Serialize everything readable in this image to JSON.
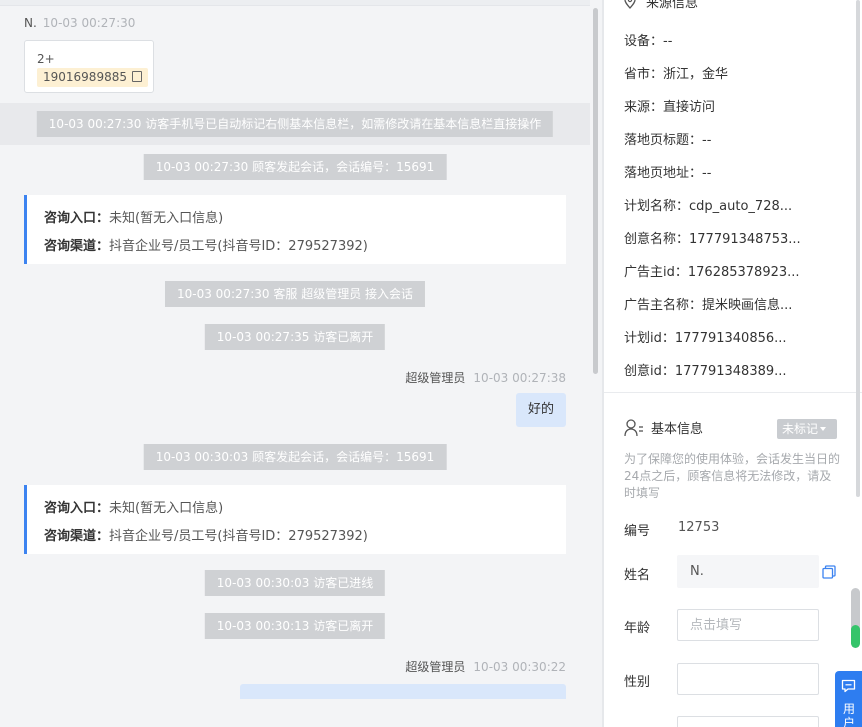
{
  "chat": {
    "contact_sender": "N.",
    "contact_time": "10-03 00:27:30",
    "contact_card": {
      "line1": "2+",
      "phone": "19016989885"
    },
    "system_msgs": [
      "10-03 00:27:30 访客手机号已自动标记右侧基本信息栏，如需修改请在基本信息栏直接操作",
      "10-03 00:27:30 顾客发起会话，会话编号：15691",
      "10-03 00:27:30 客服 超级管理员 接入会话",
      "10-03 00:27:35 访客已离开",
      "10-03 00:30:03 顾客发起会话，会话编号：15691",
      "10-03 00:30:03 访客已进线",
      "10-03 00:30:13 访客已离开"
    ],
    "info_cards": [
      {
        "entry_label": "咨询入口：",
        "entry_value": "未知(暂无入口信息)",
        "channel_label": "咨询渠道：",
        "channel_value": "抖音企业号/员工号(抖音号ID：279527392)"
      },
      {
        "entry_label": "咨询入口：",
        "entry_value": "未知(暂无入口信息)",
        "channel_label": "咨询渠道：",
        "channel_value": "抖音企业号/员工号(抖音号ID：279527392)"
      }
    ],
    "agent_msgs": [
      {
        "name": "超级管理员",
        "time": "10-03 00:27:38",
        "text": "好的"
      },
      {
        "name": "超级管理员",
        "time": "10-03 00:30:22",
        "text": ""
      }
    ]
  },
  "source_info": {
    "title": "来源信息",
    "rows": [
      {
        "label": "设备：",
        "value": "--"
      },
      {
        "label": "省市：",
        "value": "浙江，金华"
      },
      {
        "label": "来源：",
        "value": "直接访问"
      },
      {
        "label": "落地页标题：",
        "value": "--"
      },
      {
        "label": "落地页地址：",
        "value": "--"
      },
      {
        "label": "计划名称：",
        "value": "cdp_auto_728..."
      },
      {
        "label": "创意名称：",
        "value": "177791348753..."
      },
      {
        "label": "广告主id：",
        "value": "176285378923..."
      },
      {
        "label": "广告主名称：",
        "value": "提米映画信息..."
      },
      {
        "label": "计划id：",
        "value": "177791340856..."
      },
      {
        "label": "创意id：",
        "value": "177791348389..."
      }
    ]
  },
  "basic_info": {
    "title": "基本信息",
    "tag_label": "未标记",
    "notice": "为了保障您的使用体验，会话发生当日的24点之后，顾客信息将无法修改，请及时填写",
    "id_label": "编号",
    "id_value": "12753",
    "name_label": "姓名",
    "name_value": "N.",
    "age_label": "年龄",
    "age_placeholder": "点击填写",
    "gender_label": "性别",
    "gender_value": ""
  },
  "level_indicator": {
    "fraction": 0.38
  },
  "float_button": {
    "label": "用户"
  },
  "colors": {
    "accent": "#3c83f0",
    "bubble": "#d9e7fb",
    "system": "#cfd1d4",
    "success": "#35c46a"
  }
}
